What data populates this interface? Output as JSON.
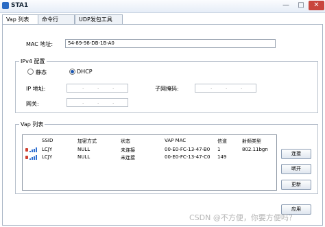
{
  "window": {
    "title": "STA1",
    "min": "—",
    "max": "□",
    "close": "✕"
  },
  "tabs": [
    "Vap 列表",
    "命令行",
    "UDP发包工具"
  ],
  "mac": {
    "label": "MAC 地址:",
    "value": "54-89-98-DB-1B-A0"
  },
  "ipv4": {
    "title": "IPv4 配置",
    "static_label": "静态",
    "dhcp_label": "DHCP",
    "selected": "DHCP",
    "ip_label": "IP 地址:",
    "mask_label": "子网掩码:",
    "gateway_label": "网关:",
    "dot": "."
  },
  "vap": {
    "title": "Vap 列表",
    "headers": [
      "SSID",
      "加密方式",
      "状态",
      "VAP MAC",
      "信道",
      "射频类型"
    ],
    "rows": [
      {
        "ssid": "LCJY",
        "enc": "NULL",
        "status": "未连接",
        "mac": "00-E0-FC-13-47-B0",
        "channel": "1",
        "radio": "802.11bgn"
      },
      {
        "ssid": "LCJY",
        "enc": "NULL",
        "status": "未连接",
        "mac": "00-E0-FC-13-47-C0",
        "channel": "149",
        "radio": ""
      }
    ]
  },
  "buttons": {
    "connect": "连接",
    "disconnect": "断开",
    "update": "更新",
    "apply": "应用"
  },
  "watermark": "CSDN @不方便，你要方便吗？",
  "colors": {
    "accent": "#1a56b0",
    "close": "#c9463d",
    "signal": "#2f6fd0",
    "lock": "#d04030"
  }
}
